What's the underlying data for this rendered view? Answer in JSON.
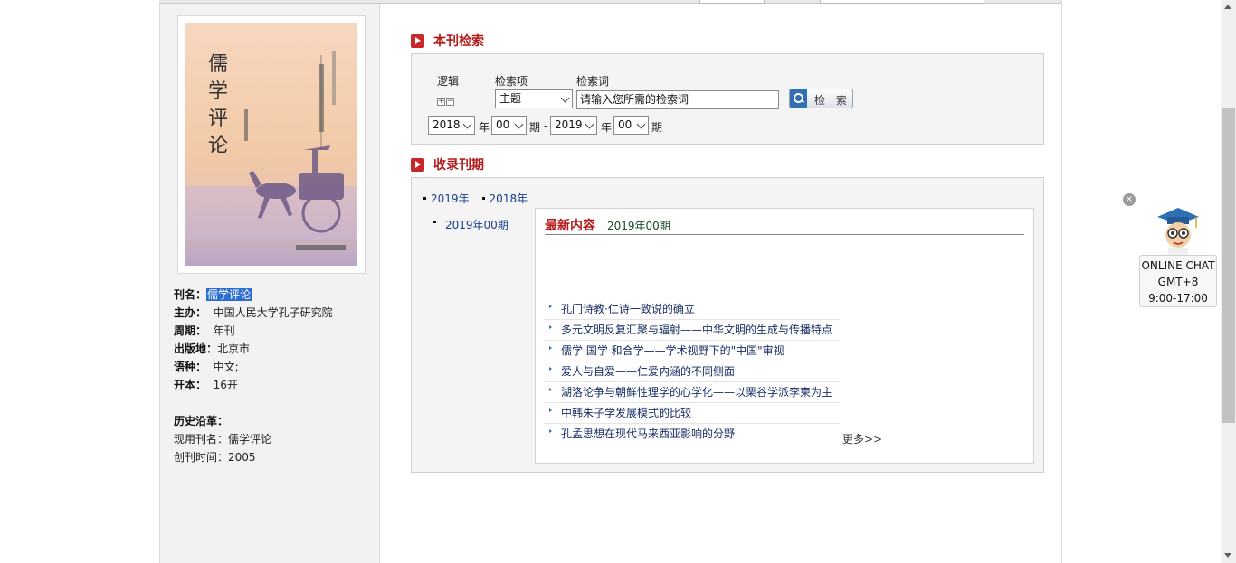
{
  "journal": {
    "cover_title": "儒学评论",
    "info": [
      {
        "label": "刊名：",
        "value": "儒学评论",
        "highlight": true
      },
      {
        "label": "主办：",
        "value": "中国人民大学孔子研究院"
      },
      {
        "label": "周期：",
        "value": "年刊"
      },
      {
        "label": "出版地：",
        "value": "北京市"
      },
      {
        "label": "语种：",
        "value": "中文;"
      },
      {
        "label": "开本：",
        "value": "16开"
      }
    ],
    "history_label": "历史沿革：",
    "current_name_label": "现用刊名：",
    "current_name": "儒学评论",
    "founded_label": "创刊时间：",
    "founded": "2005"
  },
  "search": {
    "title": "本刊检索",
    "logic_label": "逻辑",
    "field_label": "检索项",
    "term_label": "检索词",
    "field_value": "主题",
    "term_placeholder": "请输入您所需的检索词",
    "button": "检 索",
    "from_year": "2018",
    "from_issue": "00",
    "to_year": "2019",
    "to_issue": "00",
    "year_unit": "年",
    "issue_unit": "期",
    "dash": "-"
  },
  "issues": {
    "title": "收录刊期",
    "years": [
      "2019年",
      "2018年"
    ],
    "selected_issue": "2019年00期",
    "latest_title": "最新内容",
    "latest_issue": "2019年00期",
    "articles": [
      "孔门诗教·仁诗一致说的确立",
      "多元文明反复汇聚与辐射——中华文明的生成与传播特点",
      "儒学 国学 和合学——学术视野下的\"中国\"审视",
      "爱人与自爱——仁爱内涵的不同侧面",
      "湖洛论争与朝鲜性理学的心学化——以栗谷学派李柬为主",
      "中韩朱子学发展模式的比较",
      "孔孟思想在现代马来西亚影响的分野"
    ],
    "more": "更多>>"
  },
  "chat": {
    "line1": "ONLINE CHAT",
    "line2": "GMT+8",
    "line3": "9:00-17:00",
    "close": "×"
  }
}
